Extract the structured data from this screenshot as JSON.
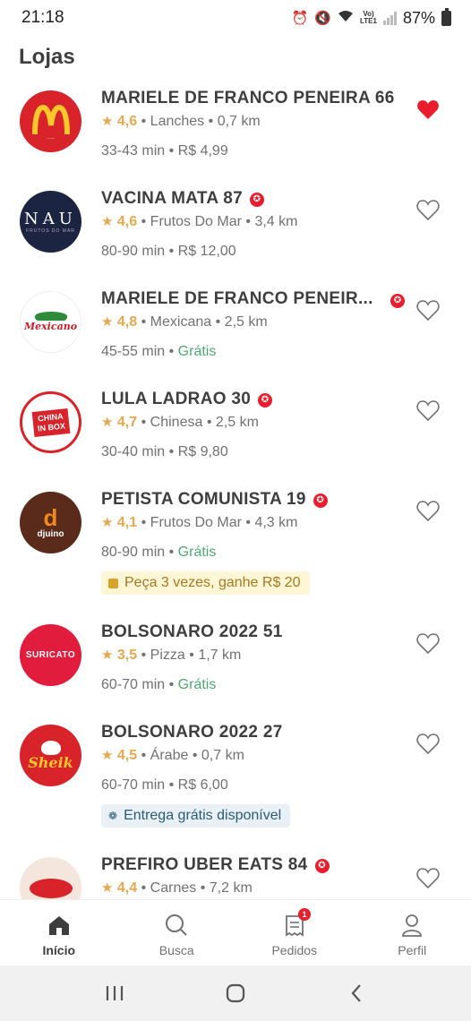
{
  "status_bar": {
    "time": "21:18",
    "battery": "87%",
    "network": "Vo)\nLTE1"
  },
  "page": {
    "title": "Lojas"
  },
  "stores": [
    {
      "name": "MARIELE DE FRANCO PENEIRA 66",
      "rating": "4,6",
      "category": "Lanches",
      "distance": "0,7 km",
      "time": "33-43 min",
      "fee": "R$ 4,99",
      "favorite": true,
      "super": false,
      "logo": "mcdonalds-logo"
    },
    {
      "name": "VACINA MATA 87",
      "rating": "4,6",
      "category": "Frutos Do Mar",
      "distance": "3,4 km",
      "time": "80-90 min",
      "fee": "R$ 12,00",
      "favorite": false,
      "super": true,
      "logo": "nau-logo",
      "logo_text": "NAU",
      "logo_sub": "FRUTOS DO MAR"
    },
    {
      "name": "MARIELE DE FRANCO PENEIR...",
      "rating": "4,8",
      "category": "Mexicana",
      "distance": "2,5 km",
      "time": "45-55 min",
      "fee": "Grátis",
      "favorite": false,
      "super": true,
      "logo": "mexicano-logo",
      "logo_text": "Mexicano"
    },
    {
      "name": "LULA LADRAO 30",
      "rating": "4,7",
      "category": "Chinesa",
      "distance": "2,5 km",
      "time": "30-40 min",
      "fee": "R$ 9,80",
      "favorite": false,
      "super": true,
      "logo": "china-in-box-logo",
      "logo_text": "CHINA IN BOX"
    },
    {
      "name": "PETISTA COMUNISTA 19",
      "rating": "4,1",
      "category": "Frutos Do Mar",
      "distance": "4,3 km",
      "time": "80-90 min",
      "fee": "Grátis",
      "favorite": false,
      "super": true,
      "logo": "djuino-logo",
      "logo_text": "djuino",
      "promo": "Peça 3 vezes, ganhe R$ 20"
    },
    {
      "name": "BOLSONARO 2022 51",
      "rating": "3,5",
      "category": "Pizza",
      "distance": "1,7 km",
      "time": "60-70 min",
      "fee": "Grátis",
      "favorite": false,
      "super": false,
      "logo": "suricato-logo",
      "logo_text": "SURICATO"
    },
    {
      "name": "BOLSONARO 2022 27",
      "rating": "4,5",
      "category": "Árabe",
      "distance": "0,7 km",
      "time": "60-70 min",
      "fee": "R$ 6,00",
      "favorite": false,
      "super": false,
      "logo": "sheik-logo",
      "logo_text": "Sheik",
      "promo": "Entrega grátis disponível"
    },
    {
      "name": "PREFIRO UBER EATS 84",
      "rating": "4,4",
      "category": "Carnes",
      "distance": "7,2 km",
      "time": "",
      "fee": "",
      "favorite": false,
      "super": true,
      "logo": "meat-logo"
    }
  ],
  "nav": {
    "items": [
      {
        "label": "Início"
      },
      {
        "label": "Busca"
      },
      {
        "label": "Pedidos",
        "badge": "1"
      },
      {
        "label": "Perfil"
      }
    ]
  },
  "separator": "•",
  "colors": {
    "brand": "#ea1d2c",
    "star": "#e7a74e",
    "free": "#50a773"
  }
}
